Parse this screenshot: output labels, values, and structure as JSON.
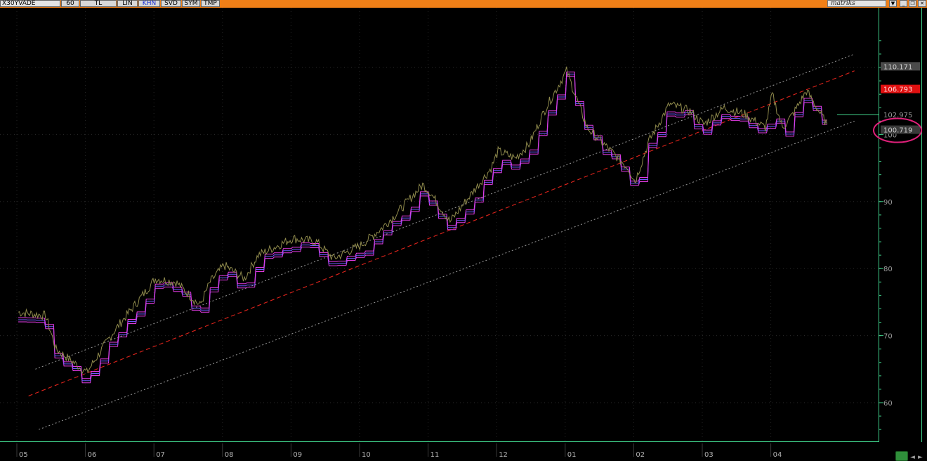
{
  "toolbar": {
    "symbol": "X30YVADE",
    "buttons": [
      "60",
      "TL",
      "LIN",
      "KHN",
      "SVD",
      "SYM",
      "TMP"
    ],
    "active_button": "KHN",
    "brand": "matriks"
  },
  "chart_data": {
    "type": "line",
    "y_axis": {
      "ticks": [
        60,
        70,
        80,
        90,
        100,
        110
      ],
      "range": [
        55,
        116
      ],
      "position": "right"
    },
    "x_axis": {
      "ticks": [
        "05",
        "06",
        "07",
        "08",
        "09",
        "10",
        "11",
        "12",
        "01",
        "02",
        "03",
        "04"
      ]
    },
    "price_labels": [
      {
        "value": "110.171",
        "color": "#4a4a4a"
      },
      {
        "value": "106.793",
        "color": "#e01010"
      },
      {
        "value": "102.975",
        "color": "#000000"
      },
      {
        "value": "100.719",
        "color": "#3a3a3a",
        "highlighted": true
      }
    ],
    "colors": {
      "price": "#8f8a4c",
      "band_outer": "#e63be6",
      "band_inner": "#6c5cff",
      "regression": "#e0241c",
      "channel": "#9a9a9a",
      "axis": "#3fd08a",
      "highlight": "#e0207a"
    },
    "series": [
      {
        "values_x_index": [
          0,
          0.4,
          0.55,
          1,
          1.35,
          1.5,
          1.85,
          2,
          2.3,
          2.65,
          2.8,
          3,
          3.3,
          3.5,
          4,
          4.35,
          4.6,
          5,
          5.3,
          5.5,
          5.9,
          6,
          6.3,
          6.6,
          6.9,
          7,
          7.25,
          7.45,
          7.7,
          8,
          8.3,
          8.6,
          8.9,
          9,
          9.2,
          9.5,
          9.8,
          10,
          10.3,
          10.6,
          10.9,
          11,
          11.15,
          11.3,
          11.5,
          11.8
        ],
        "values": [
          73.5,
          73,
          68,
          64.5,
          70,
          72,
          76.5,
          78.5,
          78,
          74.5,
          78,
          80.5,
          78.5,
          82,
          84.5,
          84,
          81.5,
          83.5,
          86,
          88,
          92.5,
          91.5,
          87,
          91,
          95,
          97.5,
          96.5,
          98.5,
          104,
          109.5,
          101,
          98,
          95,
          93,
          99,
          104.5,
          103.5,
          101.5,
          104,
          103,
          101,
          106,
          101,
          103,
          106.5,
          101.5
        ]
      }
    ],
    "trend_lines": [
      {
        "name": "",
        "x": [
          0.15,
          12.2
        ],
        "y": [
          61,
          109.5
        ]
      },
      {
        "name": "",
        "x": [
          0.25,
          12.2
        ],
        "y": [
          65,
          112
        ]
      },
      {
        "name": "",
        "x": [
          0.3,
          12.2
        ],
        "y": [
          56,
          102
        ]
      }
    ]
  }
}
